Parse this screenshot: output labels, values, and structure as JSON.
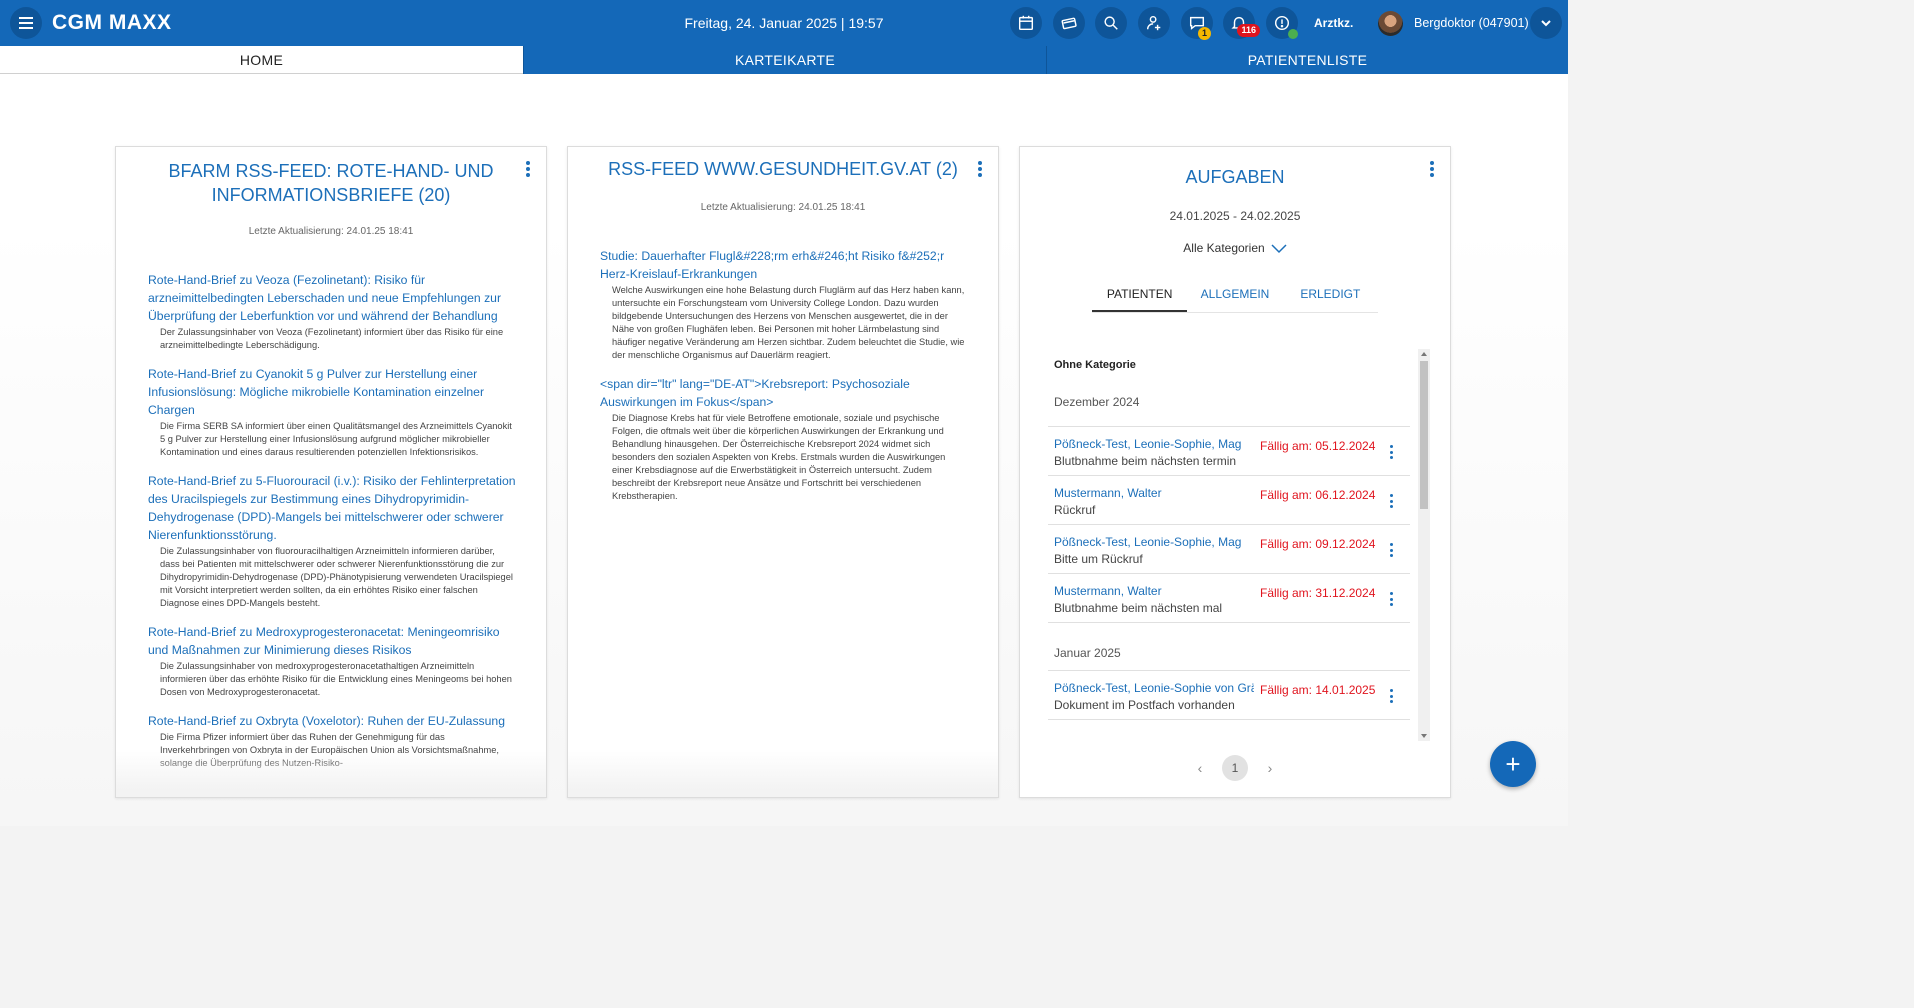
{
  "header": {
    "app_title": "CGM MAXX",
    "datetime": "Freitag, 24. Januar 2025 | 19:57",
    "icons": [
      "calendar-icon",
      "card-reader-icon",
      "search-icon",
      "add-person-icon",
      "messages-icon",
      "notifications-icon",
      "status-info-icon"
    ],
    "messages_badge": "1",
    "notifications_badge": "116",
    "arztkz_label": "Arztkz.",
    "user_name": "Bergdoktor (047901)"
  },
  "tabs": [
    {
      "label": "HOME"
    },
    {
      "label": "KARTEIKARTE"
    },
    {
      "label": "PATIENTENLISTE"
    }
  ],
  "cards": {
    "bfarm": {
      "title": "BFARM RSS-FEED: ROTE-HAND- UND INFORMATIONSBRIEFE (20)",
      "updated": "Letzte Aktualisierung: 24.01.25 18:41",
      "items": [
        {
          "title": "Rote-Hand-Brief zu Veoza (Fezolinetant): Risiko für arzneimittelbedingten Leberschaden und neue Empfehlungen zur Überprüfung der Leberfunktion vor und während der Behandlung",
          "desc": "Der Zulassungsinhaber von Veoza (Fezolinetant) informiert über das Risiko für eine arzneimittelbedingte Leberschädigung."
        },
        {
          "title": "Rote-Hand-Brief zu Cyanokit 5 g Pulver zur Herstellung einer Infusionslösung: Mögliche mikrobielle Kontamination einzelner Chargen",
          "desc": "Die Firma SERB SA informiert über einen Qualitätsmangel des Arzneimittels Cyanokit 5 g Pulver zur Herstellung einer Infusionslösung aufgrund möglicher mikrobieller Kontamination und eines daraus resultierenden potenziellen Infektionsrisikos."
        },
        {
          "title": "Rote-Hand-Brief zu 5-Fluorouracil (i.v.): Risiko der Fehlinterpretation des Uracilspiegels zur Bestimmung eines Dihydropyrimidin-Dehydrogenase (DPD)-Mangels bei mittelschwerer oder schwerer Nierenfunktionsstörung.",
          "desc": "Die Zulassungsinhaber von fluorouracilhaltigen Arzneimitteln informieren darüber, dass bei Patienten mit mittelschwerer oder schwerer Nierenfunktionsstörung die zur Dihydropyrimidin-Dehydrogenase (DPD)-Phänotypisierung verwendeten Uracilspiegel mit Vorsicht interpretiert werden sollten, da ein erhöhtes Risiko einer falschen Diagnose eines DPD-Mangels besteht."
        },
        {
          "title": "Rote-Hand-Brief zu Medroxyprogesteronacetat: Meningeomrisiko und Maßnahmen zur Minimierung dieses Risikos",
          "desc": "Die Zulassungsinhaber von medroxyprogesteronacetathaltigen Arzneimitteln informieren über das erhöhte Risiko für die Entwicklung eines Meningeoms bei hohen Dosen von Medroxyprogesteronacetat."
        },
        {
          "title": "Rote-Hand-Brief zu Oxbryta (Voxelotor): Ruhen der EU-Zulassung",
          "desc": "Die Firma Pfizer informiert über das Ruhen der Genehmigung für das Inverkehrbringen von Oxbryta in der Europäischen Union als Vorsichtsmaßnahme, solange die Überprüfung des Nutzen-Risiko-"
        }
      ]
    },
    "gesundheit": {
      "title": "RSS-FEED WWW.GESUNDHEIT.GV.AT (2)",
      "updated": "Letzte Aktualisierung: 24.01.25 18:41",
      "items": [
        {
          "title": "Studie: Dauerhafter Flugl&#228;rm erh&#246;ht Risiko f&#252;r Herz-Kreislauf-Erkrankungen",
          "desc": "Welche Auswirkungen eine hohe Belastung durch Fluglärm auf das Herz haben kann, untersuchte ein Forschungsteam vom University College London. Dazu wurden bildgebende Untersuchungen des Herzens von Menschen ausgewertet, die in der Nähe von großen Flughäfen leben. Bei Personen mit hoher Lärmbelastung sind häufiger negative Veränderung am Herzen sichtbar. Zudem beleuchtet die Studie, wie der menschliche Organismus auf Dauerlärm reagiert."
        },
        {
          "title": "<span dir=\"ltr\" lang=\"DE-AT\">Krebsreport: Psychosoziale Auswirkungen im Fokus</span>",
          "desc": "Die Diagnose Krebs hat für viele Betroffene emotionale, soziale und psychische Folgen, die oftmals weit über die körperlichen Auswirkungen der Erkrankung und Behandlung hinausgehen. Der Österreichische Krebsreport 2024 widmet sich besonders den sozialen Aspekten von Krebs. Erstmals wurden die Auswirkungen einer Krebsdiagnose auf die Erwerbstätigkeit in Österreich untersucht. Zudem beschreibt der Krebsreport neue Ansätze und Fortschritt bei verschiedenen Krebstherapien."
        }
      ]
    },
    "aufgaben": {
      "title": "AUFGABEN",
      "date_range": "24.01.2025 - 24.02.2025",
      "category_select": "Alle Kategorien",
      "tabs": [
        "PATIENTEN",
        "ALLGEMEIN",
        "ERLEDIGT"
      ],
      "group_label": "Ohne Kategorie",
      "month_dec": "Dezember  2024",
      "month_jan": "Januar  2025",
      "tasks_dec": [
        {
          "patient": "Pößneck-Test, Leonie-Sophie, Mag",
          "desc": "Blutbnahme beim nächsten termin",
          "due": "Fällig am: 05.12.2024"
        },
        {
          "patient": "Mustermann, Walter",
          "desc": "Rückruf",
          "due": "Fällig am: 06.12.2024"
        },
        {
          "patient": "Pößneck-Test, Leonie-Sophie, Mag",
          "desc": "Bitte um Rückruf",
          "due": "Fällig am: 09.12.2024"
        },
        {
          "patient": "Mustermann, Walter",
          "desc": "Blutbnahme beim nächsten mal",
          "due": "Fällig am: 31.12.2024"
        }
      ],
      "tasks_jan": [
        {
          "patient": "Pößneck-Test, Leonie-Sophie von Grä…",
          "desc": "Dokument im Postfach vorhanden",
          "due": "Fällig am: 14.01.2025"
        }
      ],
      "pager": {
        "prev": "‹",
        "page": "1",
        "next": "›"
      }
    }
  },
  "fab": {
    "label": "+"
  },
  "colors": {
    "header_blue": "#1468b8",
    "link_blue": "#1c6fb9",
    "due_red": "#e0141e"
  }
}
